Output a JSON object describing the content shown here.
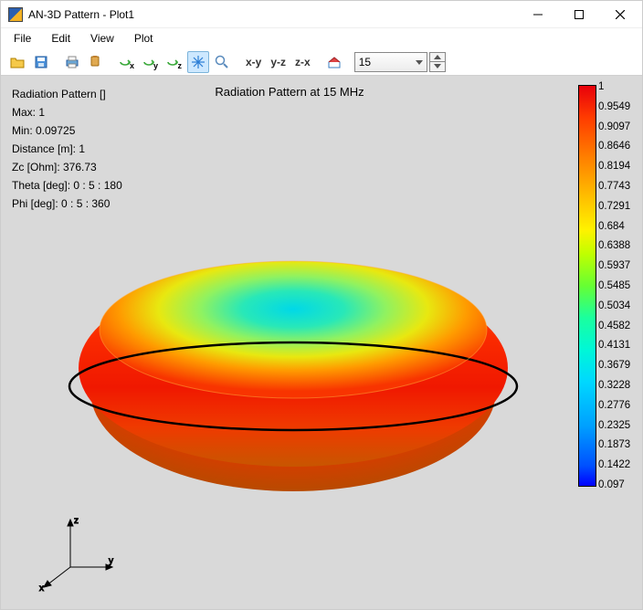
{
  "window": {
    "title": "AN-3D Pattern - Plot1"
  },
  "menubar": {
    "items": [
      "File",
      "Edit",
      "View",
      "Plot"
    ]
  },
  "toolbar": {
    "axis_labels": [
      "x",
      "y",
      "z"
    ],
    "plane_labels": [
      "x-y",
      "y-z",
      "z-x"
    ],
    "frequency_value": "15"
  },
  "plot": {
    "title": "Radiation Pattern at 15 MHz",
    "info": [
      "Radiation Pattern []",
      "Max: 1",
      "Min: 0.09725",
      "Distance [m]: 1",
      "Zc [Ohm]: 376.73",
      "Theta [deg]: 0 : 5 : 180",
      "Phi [deg]: 0 : 5 : 360"
    ],
    "axes": {
      "x": "x",
      "y": "y",
      "z": "z"
    }
  },
  "colorbar": {
    "ticks": [
      "1",
      "0.9549",
      "0.9097",
      "0.8646",
      "0.8194",
      "0.7743",
      "0.7291",
      "0.684",
      "0.6388",
      "0.5937",
      "0.5485",
      "0.5034",
      "0.4582",
      "0.4131",
      "0.3679",
      "0.3228",
      "0.2776",
      "0.2325",
      "0.1873",
      "0.1422",
      "0.097"
    ]
  },
  "chart_data": {
    "type": "surface3d",
    "subtype": "radiation-pattern-torus",
    "title": "Radiation Pattern at 15 MHz",
    "quantity": "Radiation Pattern []",
    "max": 1,
    "min": 0.09725,
    "distance_m": 1,
    "zc_ohm": 376.73,
    "theta_deg": {
      "start": 0,
      "step": 5,
      "stop": 180
    },
    "phi_deg": {
      "start": 0,
      "step": 5,
      "stop": 360
    },
    "colorbar_range": [
      0.097,
      1
    ],
    "colorbar_ticks": [
      1,
      0.9549,
      0.9097,
      0.8646,
      0.8194,
      0.7743,
      0.7291,
      0.684,
      0.6388,
      0.5937,
      0.5485,
      0.5034,
      0.4582,
      0.4131,
      0.3679,
      0.3228,
      0.2776,
      0.2325,
      0.1873,
      0.1422,
      0.097
    ],
    "frequency_mhz": 15
  }
}
